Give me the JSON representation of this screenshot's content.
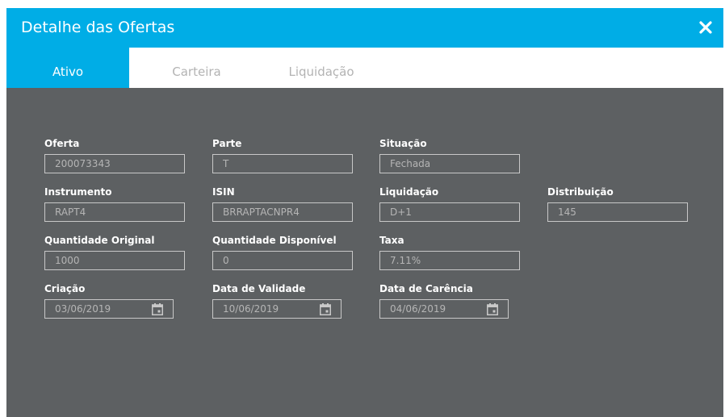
{
  "dialog": {
    "title": "Detalhe das Ofertas",
    "close_icon": "close-icon"
  },
  "tabs": [
    {
      "label": "Ativo",
      "active": true
    },
    {
      "label": "Carteira",
      "active": false
    },
    {
      "label": "Liquidação",
      "active": false
    }
  ],
  "fields": {
    "oferta": {
      "label": "Oferta",
      "value": "200073343"
    },
    "parte": {
      "label": "Parte",
      "value": "T"
    },
    "situacao": {
      "label": "Situação",
      "value": "Fechada"
    },
    "instrumento": {
      "label": "Instrumento",
      "value": "RAPT4"
    },
    "isin": {
      "label": "ISIN",
      "value": "BRRAPTACNPR4"
    },
    "liquidacao": {
      "label": "Liquidação",
      "value": "D+1"
    },
    "distribuicao": {
      "label": "Distribuição",
      "value": "145"
    },
    "quantidade_original": {
      "label": "Quantidade Original",
      "value": "1000"
    },
    "quantidade_disponivel": {
      "label": "Quantidade Disponível",
      "value": "0"
    },
    "taxa": {
      "label": "Taxa",
      "value": "7.11%"
    },
    "criacao": {
      "label": "Criação",
      "value": "03/06/2019",
      "icon": "calendar-icon"
    },
    "data_validade": {
      "label": "Data de Validade",
      "value": "10/06/2019",
      "icon": "calendar-icon"
    },
    "data_carencia": {
      "label": "Data de Carência",
      "value": "04/06/2019",
      "icon": "calendar-icon"
    }
  },
  "colors": {
    "accent": "#00ade6",
    "panel": "#5d6062",
    "field_text": "#b5b5b5"
  }
}
